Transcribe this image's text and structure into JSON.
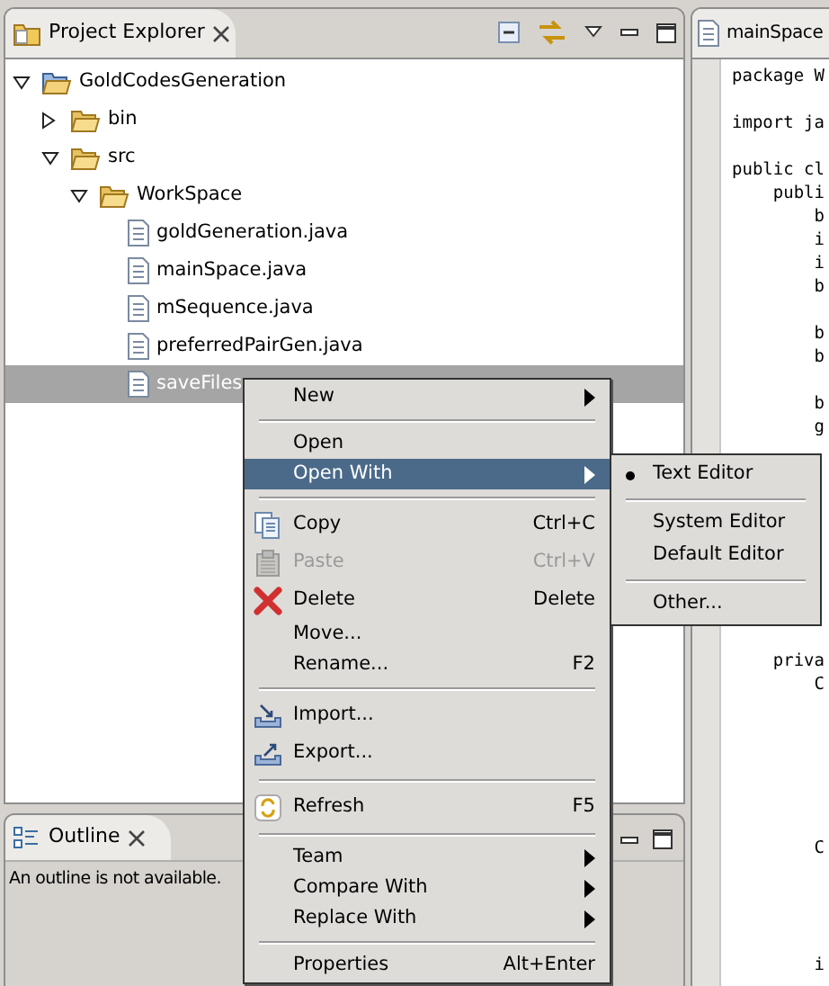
{
  "project_explorer": {
    "tab": {
      "title": "Project Explorer"
    },
    "tree": [
      {
        "label": "GoldCodesGeneration",
        "kind": "project",
        "expanded": true,
        "selected": false,
        "children": [
          {
            "label": "bin",
            "kind": "folder",
            "expanded": false,
            "selected": false
          },
          {
            "label": "src",
            "kind": "folder",
            "expanded": true,
            "selected": false,
            "children": [
              {
                "label": "WorkSpace",
                "kind": "folder",
                "expanded": true,
                "selected": false,
                "children": [
                  {
                    "label": "goldGeneration.java",
                    "kind": "file",
                    "selected": false
                  },
                  {
                    "label": "mainSpace.java",
                    "kind": "file",
                    "selected": false
                  },
                  {
                    "label": "mSequence.java",
                    "kind": "file",
                    "selected": false
                  },
                  {
                    "label": "preferredPairGen.java",
                    "kind": "file",
                    "selected": false
                  },
                  {
                    "label": "saveFiles",
                    "kind": "file",
                    "selected": true
                  }
                ]
              }
            ]
          }
        ]
      }
    ]
  },
  "outline": {
    "tab": {
      "title": "Outline"
    },
    "message": "An outline is not available."
  },
  "editor": {
    "tab": {
      "title": "mainSpace"
    },
    "code": "package W\n\nimport ja\n\npublic cl\n    publi\n        b\n        i\n        i\n        b\n\n        b\n        b\n\n        b\n        g\n\n\n\n\n\n\n\n\n\n    priva\n        C\n\n\n\n\n\n\n        C\n\n\n\n\n        i"
  },
  "context_menu": {
    "items": [
      {
        "kind": "item",
        "label": "New",
        "submenu": true,
        "selected": false,
        "disabled": false
      },
      {
        "kind": "separator"
      },
      {
        "kind": "item",
        "label": "Open",
        "selected": false,
        "disabled": false
      },
      {
        "kind": "item",
        "label": "Open With",
        "submenu": true,
        "selected": true,
        "disabled": false
      },
      {
        "kind": "separator"
      },
      {
        "kind": "item",
        "label": "Copy",
        "shortcut": "Ctrl+C",
        "selected": false,
        "disabled": false
      },
      {
        "kind": "item",
        "label": "Paste",
        "shortcut": "Ctrl+V",
        "selected": false,
        "disabled": true
      },
      {
        "kind": "item",
        "label": "Delete",
        "shortcut": "Delete",
        "selected": false,
        "disabled": false
      },
      {
        "kind": "item",
        "label": "Move...",
        "selected": false,
        "disabled": false
      },
      {
        "kind": "item",
        "label": "Rename...",
        "shortcut": "F2",
        "selected": false,
        "disabled": false
      },
      {
        "kind": "separator"
      },
      {
        "kind": "item",
        "label": "Import...",
        "selected": false,
        "disabled": false
      },
      {
        "kind": "item",
        "label": "Export...",
        "selected": false,
        "disabled": false
      },
      {
        "kind": "separator"
      },
      {
        "kind": "item",
        "label": "Refresh",
        "shortcut": "F5",
        "selected": false,
        "disabled": false
      },
      {
        "kind": "separator"
      },
      {
        "kind": "item",
        "label": "Team",
        "submenu": true,
        "selected": false,
        "disabled": false
      },
      {
        "kind": "item",
        "label": "Compare With",
        "submenu": true,
        "selected": false,
        "disabled": false
      },
      {
        "kind": "item",
        "label": "Replace With",
        "submenu": true,
        "selected": false,
        "disabled": false
      },
      {
        "kind": "separator"
      },
      {
        "kind": "item",
        "label": "Properties",
        "shortcut": "Alt+Enter",
        "selected": false,
        "disabled": false
      }
    ]
  },
  "open_with_submenu": {
    "items": [
      {
        "kind": "item",
        "label": "Text Editor",
        "checked": true
      },
      {
        "kind": "separator"
      },
      {
        "kind": "item",
        "label": "System Editor",
        "checked": false
      },
      {
        "kind": "item",
        "label": "Default Editor",
        "checked": false
      },
      {
        "kind": "separator"
      },
      {
        "kind": "item",
        "label": "Other...",
        "checked": false
      }
    ]
  }
}
